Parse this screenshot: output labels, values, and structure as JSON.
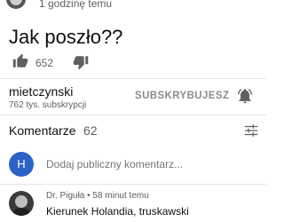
{
  "post": {
    "time_ago": "1 godzinę temu",
    "text": "Jak poszło??",
    "likes": "652"
  },
  "channel": {
    "name": "mietczynski",
    "subscribers": "762 tys. subskrypcji",
    "subscribe_label": "SUBSKRYBUJESZ"
  },
  "comments": {
    "title": "Komentarze",
    "count": "62",
    "input_placeholder": "Dodaj publiczny komentarz...",
    "user_initial": "H",
    "items": [
      {
        "author": "Dr. Piguła",
        "time_ago": "58 minut temu",
        "text": "Kierunek Holandia, truskawski"
      }
    ]
  },
  "icons": {
    "like": "thumbs-up-icon",
    "dislike": "thumbs-down-icon",
    "bell": "bell-icon",
    "sort": "sort-icon"
  },
  "colors": {
    "user_avatar": "#2a62c7",
    "secondary_text": "#606060",
    "divider": "#e5e5e5"
  }
}
